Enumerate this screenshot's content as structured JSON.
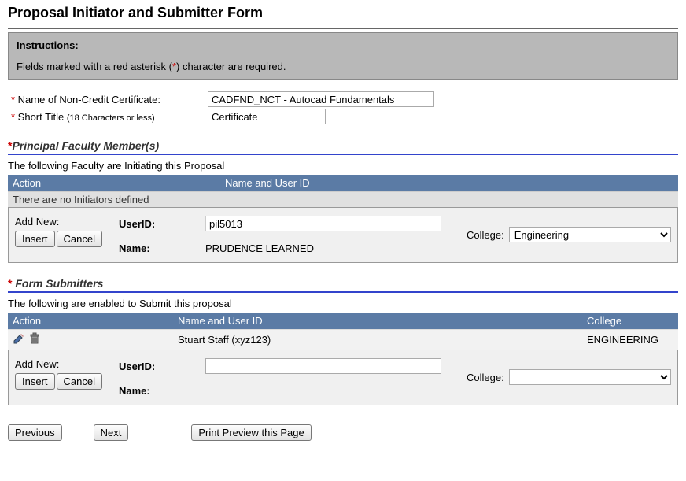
{
  "page_title": "Proposal Initiator and Submitter Form",
  "instructions": {
    "title": "Instructions:",
    "text_pre": "Fields marked with a red asterisk (",
    "text_star": "*",
    "text_post": ") character are required."
  },
  "fields": {
    "name_cert": {
      "label": "Name of Non-Credit Certificate:",
      "value": "CADFND_NCT - Autocad Fundamentals"
    },
    "short_title": {
      "label": "Short Title",
      "note": "(18 Characters or less)",
      "value": "Certificate"
    }
  },
  "sections": {
    "principal": {
      "title": "Principal Faculty Member(s)",
      "subheader": "The following Faculty are Initiating this Proposal",
      "columns": {
        "action": "Action",
        "nameid": "Name and User ID"
      },
      "empty_msg": "There are no Initiators defined",
      "addnew": {
        "label": "Add New:",
        "insert": "Insert",
        "cancel": "Cancel",
        "userid_label": "UserID:",
        "userid_value": "pil5013",
        "name_label": "Name:",
        "name_value": "PRUDENCE LEARNED",
        "college_label": "College:",
        "college_value": "Engineering"
      }
    },
    "submitters": {
      "title": "Form Submitters",
      "subheader": "The following are enabled to Submit this proposal",
      "columns": {
        "action": "Action",
        "nameid": "Name and User ID",
        "college": "College"
      },
      "rows": [
        {
          "nameid": "Stuart Staff (xyz123)",
          "college": "ENGINEERING"
        }
      ],
      "addnew": {
        "label": "Add New:",
        "insert": "Insert",
        "cancel": "Cancel",
        "userid_label": "UserID:",
        "userid_value": "",
        "name_label": "Name:",
        "name_value": "",
        "college_label": "College:",
        "college_value": ""
      }
    }
  },
  "footer": {
    "previous": "Previous",
    "next": "Next",
    "print": "Print Preview this Page"
  }
}
